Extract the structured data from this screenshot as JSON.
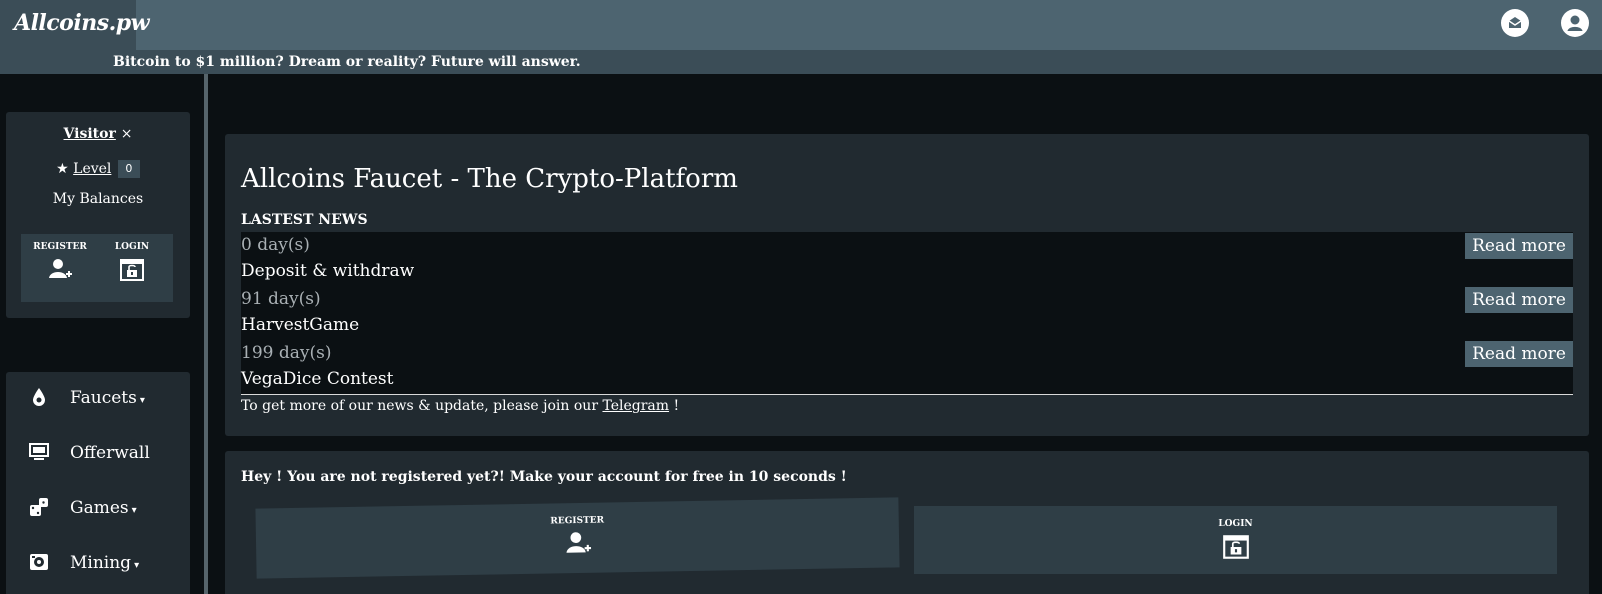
{
  "header": {
    "logo": "Allcoins.pw",
    "ticker": "Bitcoin to $1 million? Dream or reality? Future will answer."
  },
  "user_panel": {
    "visitor": "Visitor",
    "close": "×",
    "level_label": "Level",
    "level_value": "0",
    "balances": "My Balances",
    "register": "REGISTER",
    "login": "LOGIN"
  },
  "nav": {
    "items": [
      {
        "label": "Faucets",
        "caret": "▾",
        "icon": "water-drop-icon"
      },
      {
        "label": "Offerwall",
        "caret": "",
        "icon": "monitor-icon"
      },
      {
        "label": "Games",
        "caret": "▾",
        "icon": "dice-icon"
      },
      {
        "label": "Mining",
        "caret": "▾",
        "icon": "mining-icon"
      }
    ]
  },
  "news": {
    "title": "Allcoins Faucet - The Crypto-Platform",
    "heading": "LASTEST NEWS",
    "read_more": "Read more",
    "items": [
      {
        "days": "0 day(s)",
        "name": "Deposit & withdraw"
      },
      {
        "days": "91 day(s)",
        "name": "HarvestGame"
      },
      {
        "days": "199 day(s)",
        "name": "VegaDice Contest"
      }
    ],
    "footer_before": "To get more of our news & update, please join our",
    "footer_link": "Telegram",
    "footer_after": "!"
  },
  "register_card": {
    "heading": "Hey ! You are not registered yet?! Make your account for free in 10 seconds !",
    "register": "REGISTER",
    "login": "LOGIN"
  },
  "colors": {
    "topbar": "#4d6470",
    "background": "#0b1013",
    "card": "#212a30",
    "button": "#4d6470"
  }
}
